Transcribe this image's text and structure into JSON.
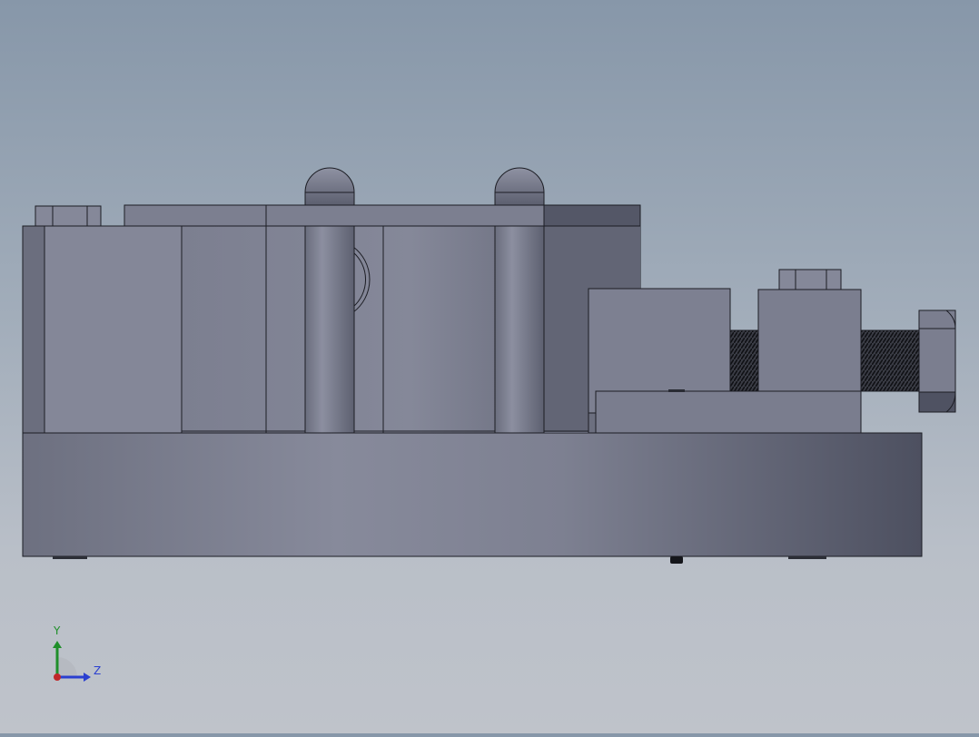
{
  "app": {
    "view": "cad-model-viewport",
    "model": "fixture-assembly-side-view"
  },
  "triad": {
    "y_label": "Y",
    "z_label": "Z",
    "y_color": "#1f8f2a",
    "z_color": "#2a3fd0",
    "origin_color": "#c0282a"
  },
  "colors": {
    "background_top": "#8797a9",
    "background_bottom": "#bfc3ca",
    "part_light": "#8a8d9e",
    "part_mid": "#767a8b",
    "part_dark": "#4f5262",
    "edge": "#1c1d24"
  }
}
